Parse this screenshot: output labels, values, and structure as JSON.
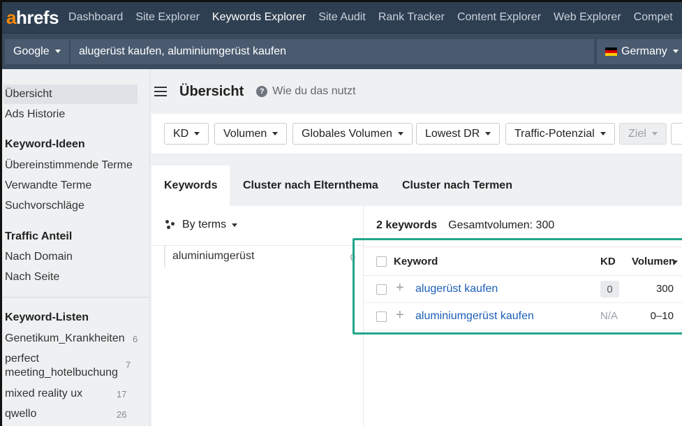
{
  "app": {
    "logo_a": "a",
    "logo_rest": "hrefs",
    "nav": [
      "Dashboard",
      "Site Explorer",
      "Keywords Explorer",
      "Site Audit",
      "Rank Tracker",
      "Content Explorer",
      "Web Explorer",
      "Compet"
    ],
    "active_nav": "Keywords Explorer"
  },
  "search": {
    "engine": "Google",
    "query": "alugerüst kaufen, aluminiumgerüst kaufen",
    "country": "Germany"
  },
  "sidebar": {
    "overview": "Übersicht",
    "ads_history": "Ads Historie",
    "ideas_heading": "Keyword-Ideen",
    "matching_terms": "Übereinstimmende Terme",
    "related_terms": "Verwandte Terme",
    "suggestions": "Suchvorschläge",
    "traffic_heading": "Traffic Anteil",
    "by_domain": "Nach Domain",
    "by_page": "Nach Seite",
    "lists_heading": "Keyword-Listen",
    "lists": [
      {
        "name": "Genetikum_Krankheiten",
        "count": "6"
      },
      {
        "name_line1": "perfect",
        "name_line2": "meeting_hotelbuchung",
        "count": "7"
      },
      {
        "name": "mixed reality ux",
        "count": "17"
      },
      {
        "name": "qwello",
        "count": "26"
      }
    ]
  },
  "main": {
    "title": "Übersicht",
    "help": "Wie du das nutzt",
    "filters": [
      "KD",
      "Volumen",
      "Globales Volumen",
      "Lowest DR",
      "Traffic-Potenzial",
      "Ziel"
    ],
    "tabs": [
      "Keywords",
      "Cluster nach Elternthema",
      "Cluster nach Termen"
    ],
    "group_by": "By terms",
    "terms": [
      {
        "label": "aluminiumgerüst",
        "count": "0"
      }
    ],
    "summary_count": "2 keywords",
    "summary_volume": "Gesamtvolumen: 300",
    "table": {
      "headers": {
        "keyword": "Keyword",
        "kd": "KD",
        "volume": "Volumen"
      },
      "rows": [
        {
          "keyword": "alugerüst kaufen",
          "kd": "0",
          "volume": "300"
        },
        {
          "keyword": "aluminiumgerüst kaufen",
          "kd": "N/A",
          "volume": "0–10"
        }
      ]
    }
  },
  "colors": {
    "nav_bg": "#2f3f52",
    "accent_logo": "#ff8800",
    "link": "#1c5fb8",
    "highlight": "#1fa68a"
  }
}
